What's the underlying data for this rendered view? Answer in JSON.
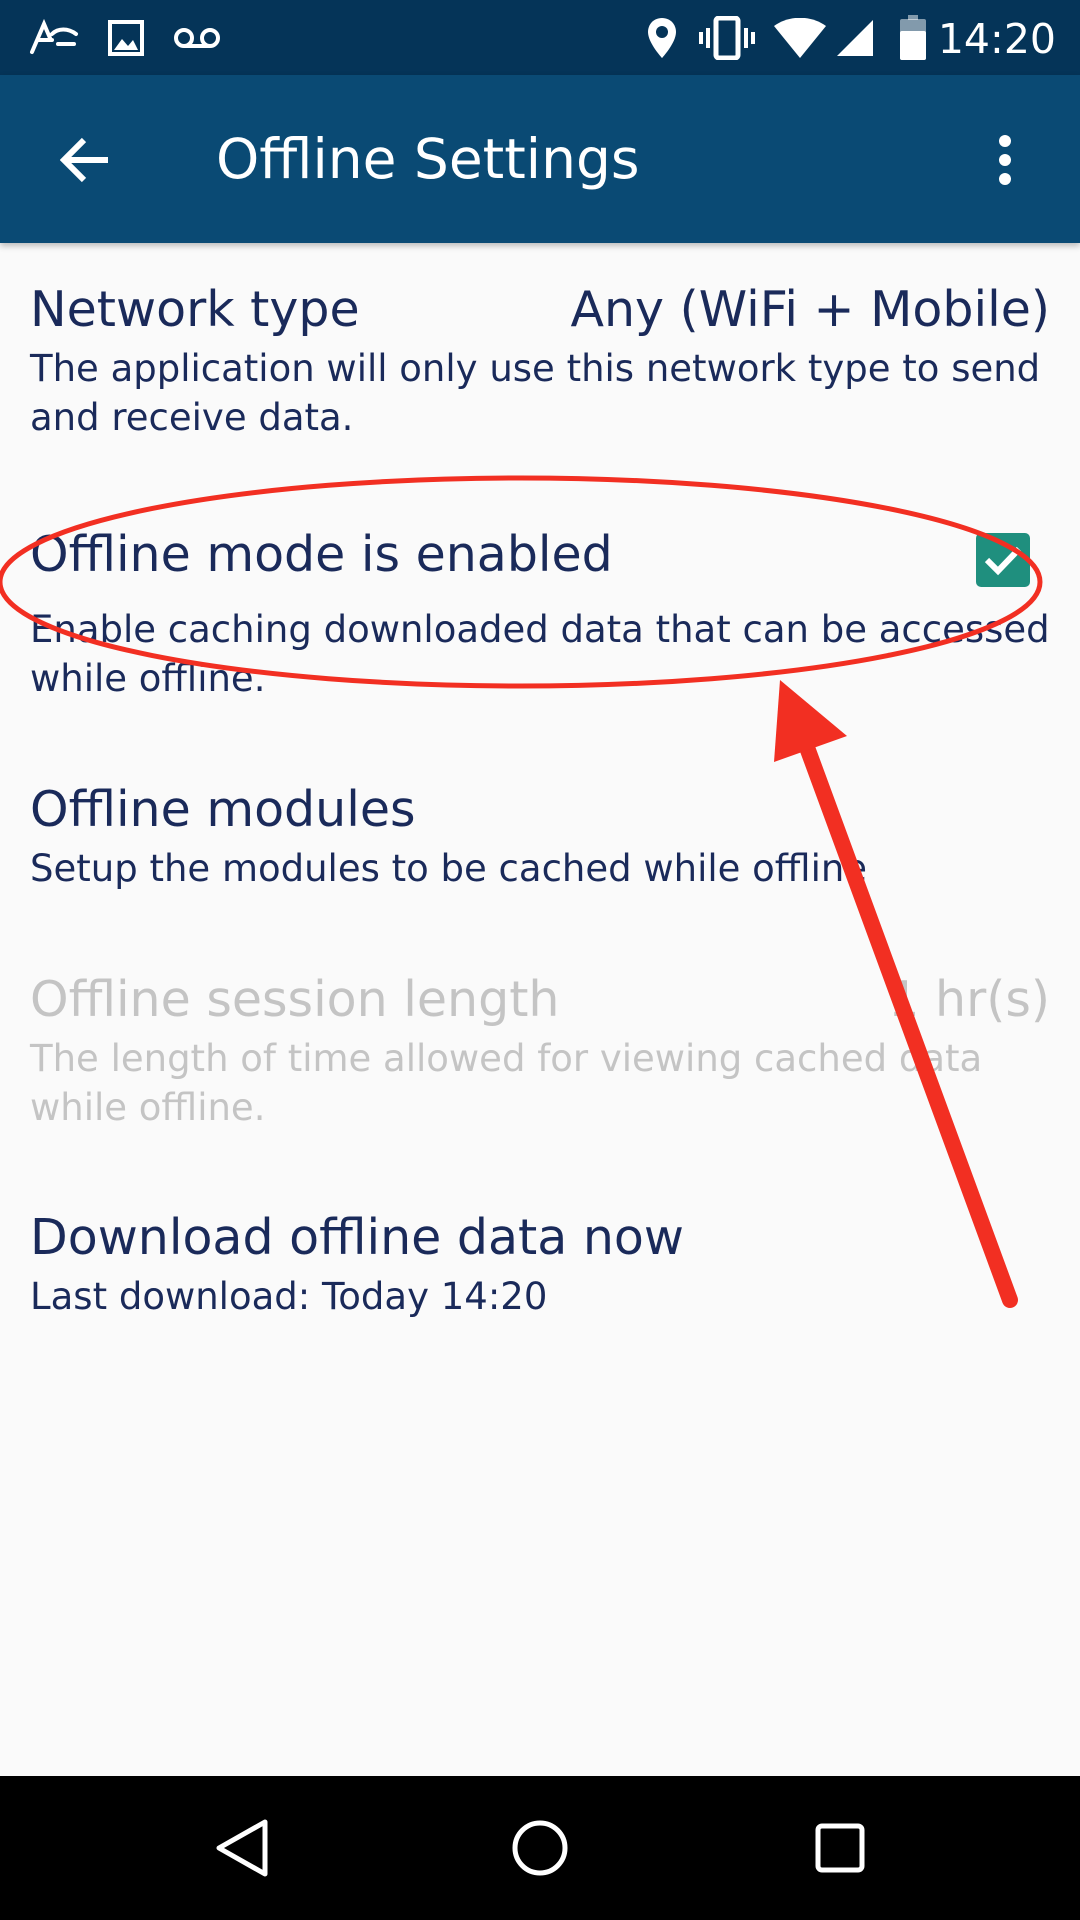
{
  "status_bar": {
    "time": "14:20",
    "left_icons": [
      "app-notification-icon",
      "image-icon",
      "voicemail-icon"
    ],
    "right_icons": [
      "location-icon",
      "vibrate-icon",
      "wifi-icon",
      "cell-signal-icon",
      "battery-icon"
    ]
  },
  "app_bar": {
    "title": "Offline Settings",
    "back_icon": "arrow-back-icon",
    "menu_icon": "more-vert-icon",
    "color": "#0a4a74"
  },
  "settings": {
    "network_type": {
      "title": "Network type",
      "value": "Any (WiFi + Mobile)",
      "summary": "The application will only use this network type to send and receive data."
    },
    "offline_mode": {
      "title": "Offline mode is enabled",
      "summary": "Enable caching downloaded data that can be accessed while offline.",
      "checked": true,
      "checkbox_color": "#1f8f7e"
    },
    "offline_modules": {
      "title": "Offline modules",
      "summary": "Setup the modules to be cached while offline"
    },
    "session_length": {
      "title": "Offline session length",
      "value": "1 hr(s)",
      "summary": "The length of time allowed for viewing cached data while offline.",
      "enabled": false
    },
    "download_now": {
      "title": "Download offline data now",
      "summary": "Last download: Today 14:20"
    }
  },
  "nav_bar": {
    "buttons": [
      "back-triangle-icon",
      "home-circle-icon",
      "recents-square-icon"
    ]
  },
  "annotation": {
    "color": "#f22f22"
  }
}
